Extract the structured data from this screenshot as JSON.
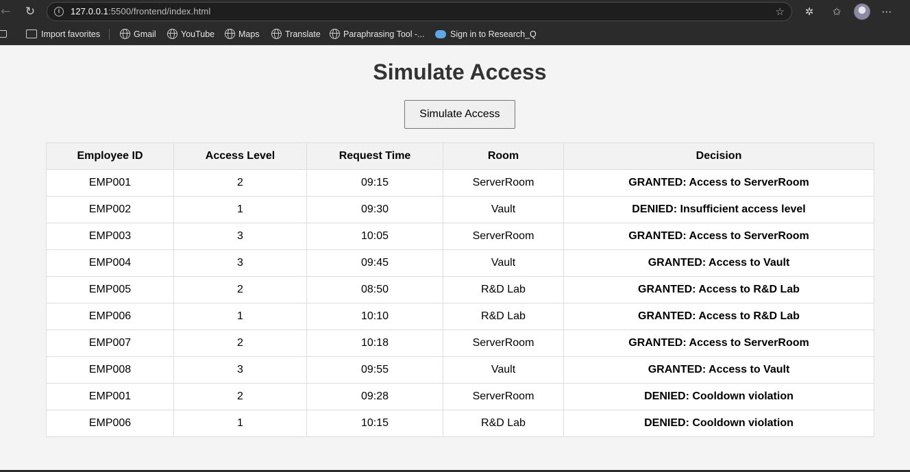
{
  "browser": {
    "url_host": "127.0.0.1",
    "url_rest": ":5500/frontend/index.html",
    "bookmarks": [
      {
        "label": "Import favorites",
        "icon": "folder-icon"
      },
      {
        "label": "Gmail",
        "icon": "globe-icon"
      },
      {
        "label": "YouTube",
        "icon": "globe-icon"
      },
      {
        "label": "Maps",
        "icon": "globe-icon"
      },
      {
        "label": "Translate",
        "icon": "globe-icon"
      },
      {
        "label": "Paraphrasing Tool -...",
        "icon": "globe-icon"
      },
      {
        "label": "Sign in to Research_Q",
        "icon": "researchq-icon"
      }
    ]
  },
  "page": {
    "title": "Simulate Access",
    "button_label": "Simulate Access"
  },
  "table": {
    "headers": [
      "Employee ID",
      "Access Level",
      "Request Time",
      "Room",
      "Decision"
    ],
    "rows": [
      {
        "employee_id": "EMP001",
        "access_level": "2",
        "request_time": "09:15",
        "room": "ServerRoom",
        "decision": "GRANTED: Access to ServerRoom",
        "status": "granted"
      },
      {
        "employee_id": "EMP002",
        "access_level": "1",
        "request_time": "09:30",
        "room": "Vault",
        "decision": "DENIED: Insufficient access level",
        "status": "denied"
      },
      {
        "employee_id": "EMP003",
        "access_level": "3",
        "request_time": "10:05",
        "room": "ServerRoom",
        "decision": "GRANTED: Access to ServerRoom",
        "status": "granted"
      },
      {
        "employee_id": "EMP004",
        "access_level": "3",
        "request_time": "09:45",
        "room": "Vault",
        "decision": "GRANTED: Access to Vault",
        "status": "granted"
      },
      {
        "employee_id": "EMP005",
        "access_level": "2",
        "request_time": "08:50",
        "room": "R&D Lab",
        "decision": "GRANTED: Access to R&D Lab",
        "status": "granted"
      },
      {
        "employee_id": "EMP006",
        "access_level": "1",
        "request_time": "10:10",
        "room": "R&D Lab",
        "decision": "GRANTED: Access to R&D Lab",
        "status": "granted"
      },
      {
        "employee_id": "EMP007",
        "access_level": "2",
        "request_time": "10:18",
        "room": "ServerRoom",
        "decision": "GRANTED: Access to ServerRoom",
        "status": "granted"
      },
      {
        "employee_id": "EMP008",
        "access_level": "3",
        "request_time": "09:55",
        "room": "Vault",
        "decision": "GRANTED: Access to Vault",
        "status": "granted"
      },
      {
        "employee_id": "EMP001",
        "access_level": "2",
        "request_time": "09:28",
        "room": "ServerRoom",
        "decision": "DENIED: Cooldown violation",
        "status": "denied"
      },
      {
        "employee_id": "EMP006",
        "access_level": "1",
        "request_time": "10:15",
        "room": "R&D Lab",
        "decision": "DENIED: Cooldown violation",
        "status": "denied"
      }
    ]
  },
  "colors": {
    "granted": "#0a8a0a",
    "denied": "#e50000",
    "title": "#333333"
  }
}
